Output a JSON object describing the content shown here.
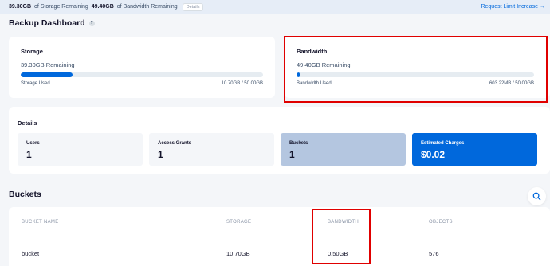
{
  "topbar": {
    "storage_remaining": "39.30GB",
    "storage_text": "of Storage Remaining",
    "bandwidth_remaining": "49.40GB",
    "bandwidth_text": "of Bandwidth Remaining",
    "details_badge": "Details",
    "request_link": "Request Limit Increase →"
  },
  "page": {
    "title": "Backup Dashboard"
  },
  "storage": {
    "title": "Storage",
    "remaining": "39.30GB Remaining",
    "used_label": "Storage Used",
    "used_value": "10.70GB / 50.00GB",
    "used_fraction": 0.214
  },
  "bandwidth": {
    "title": "Bandwidth",
    "remaining": "49.40GB Remaining",
    "used_label": "Bandwidth Used",
    "used_value": "603.22MB / 50.00GB",
    "used_fraction": 0.012
  },
  "details": {
    "title": "Details",
    "stats": [
      {
        "label": "Users",
        "value": "1"
      },
      {
        "label": "Access Grants",
        "value": "1"
      },
      {
        "label": "Buckets",
        "value": "1"
      },
      {
        "label": "Estimated Charges",
        "value": "$0.02"
      }
    ]
  },
  "buckets": {
    "title": "Buckets",
    "columns": [
      "BUCKET NAME",
      "STORAGE",
      "BANDWIDTH",
      "OBJECTS"
    ],
    "rows": [
      {
        "name": "bucket",
        "storage": "10.70GB",
        "bandwidth": "0.50GB",
        "objects": "576"
      }
    ]
  },
  "colors": {
    "accent": "#0068dc",
    "highlight": "#e00000",
    "selected_stat": "#b4c6e0"
  },
  "icons": {
    "info": "info-icon",
    "search": "search-icon"
  }
}
